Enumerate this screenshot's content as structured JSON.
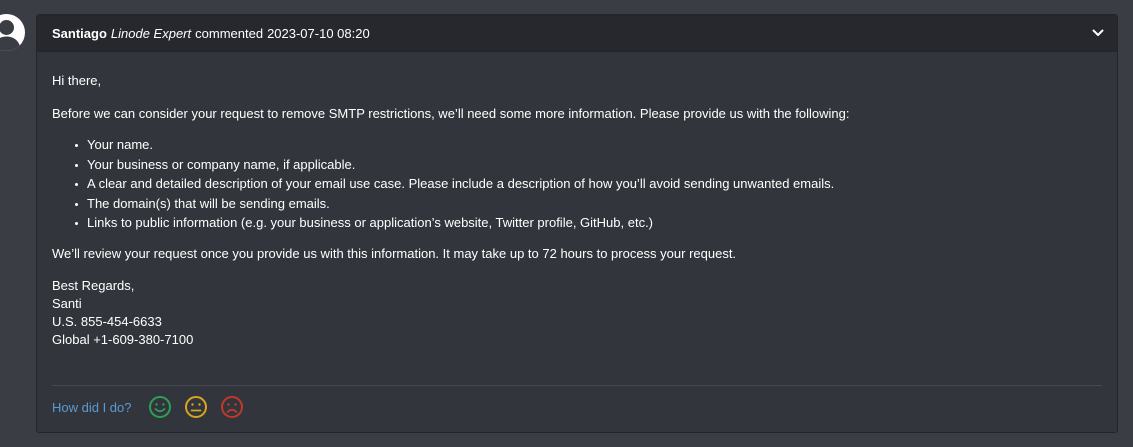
{
  "comment": {
    "author": "Santiago",
    "role": "Linode Expert",
    "action": "commented",
    "timestamp": "2023-07-10 08:20",
    "body": {
      "greeting": "Hi there,",
      "intro": "Before we can consider your request to remove SMTP restrictions, we’ll need some more information. Please provide us with the following:",
      "requirements": [
        "Your name.",
        "Your business or company name, if applicable.",
        "A clear and detailed description of your email use case. Please include a description of how you’ll avoid sending unwanted emails.",
        "The domain(s) that will be sending emails.",
        "Links to public information (e.g. your business or application’s website, Twitter profile, GitHub, etc.)"
      ],
      "review_note": "We’ll review your request once you provide us with this information. It may take up to 72 hours to process your request.",
      "signature": [
        "Best Regards,",
        "Santi",
        "U.S. 855-454-6633",
        "Global +1-609-380-7100"
      ]
    }
  },
  "rating": {
    "prompt": "How did I do?",
    "options": [
      {
        "icon": "happy-face-icon",
        "color": "#2e9e5b"
      },
      {
        "icon": "neutral-face-icon",
        "color": "#d9a520"
      },
      {
        "icon": "sad-face-icon",
        "color": "#c0392b"
      }
    ]
  },
  "colors": {
    "page_bg": "#3a3d44",
    "card_bg": "#32353b",
    "header_bg": "#26282d",
    "link": "#5b9bd5"
  }
}
